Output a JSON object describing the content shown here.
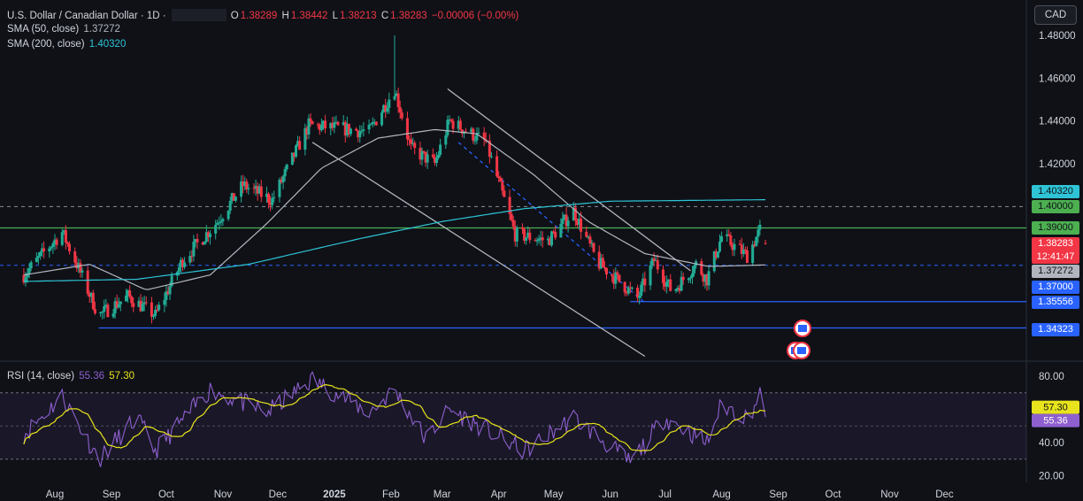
{
  "header": {
    "symbol": "U.S. Dollar / Canadian Dollar · 1D ·",
    "ohlc": {
      "o_label": "O",
      "o": "1.38289",
      "h_label": "H",
      "h": "1.38442",
      "l_label": "L",
      "l": "1.38213",
      "c_label": "C",
      "c": "1.38283",
      "change": "−0.00006 (−0.00%)"
    },
    "sma50_label": "SMA (50, close)",
    "sma50_value": "1.37272",
    "sma200_label": "SMA (200, close)",
    "sma200_value": "1.40320",
    "currency": "CAD"
  },
  "price_labels": {
    "sma200": "1.40320",
    "level_140": "1.40000",
    "level_139": "1.39000",
    "last": "1.38283",
    "countdown": "12:41:47",
    "sma50": "1.37272",
    "level_137": "1.37000",
    "level_1355": "1.35556",
    "level_1343": "1.34323"
  },
  "rsi_legend": {
    "label": "RSI (14, close)",
    "rsi": "55.36",
    "ma": "57.30"
  },
  "colors": {
    "up": "#22ab94",
    "down": "#f23645",
    "sma50": "#b2b5be",
    "sma200": "#2ec4d6",
    "green_level": "#4caf50",
    "blue_level": "#2962ff",
    "rsi": "#8e5fcf",
    "rsi_ma": "#e8e31c"
  },
  "chart_data": {
    "type": "candlestick",
    "title": "U.S. Dollar / Canadian Dollar · 1D",
    "price_axis": {
      "ticks": [
        "1.48000",
        "1.46000",
        "1.44000",
        "1.42000"
      ],
      "range": [
        1.33,
        1.48
      ]
    },
    "time_axis": {
      "ticks": [
        "Aug",
        "Sep",
        "Oct",
        "Nov",
        "Dec",
        "2025",
        "Feb",
        "Mar",
        "Apr",
        "May",
        "Jun",
        "Jul",
        "Aug",
        "Sep",
        "Oct",
        "Nov",
        "Dec"
      ]
    },
    "last_ohlc": {
      "open": 1.38289,
      "high": 1.38442,
      "low": 1.38213,
      "close": 1.38283,
      "change": -6e-05
    },
    "sma50_last": 1.37272,
    "sma200_last": 1.4032,
    "price_anchors": [
      {
        "date": "2024-07-15",
        "close": 1.368
      },
      {
        "date": "2024-08-05",
        "close": 1.388
      },
      {
        "date": "2024-08-12",
        "close": 1.375
      },
      {
        "date": "2024-08-25",
        "close": 1.349
      },
      {
        "date": "2024-09-10",
        "close": 1.358
      },
      {
        "date": "2024-09-25",
        "close": 1.349
      },
      {
        "date": "2024-10-10",
        "close": 1.375
      },
      {
        "date": "2024-10-28",
        "close": 1.392
      },
      {
        "date": "2024-11-12",
        "close": 1.41
      },
      {
        "date": "2024-11-28",
        "close": 1.403
      },
      {
        "date": "2024-12-18",
        "close": 1.438
      },
      {
        "date": "2025-01-20",
        "close": 1.435
      },
      {
        "date": "2025-02-03",
        "close": 1.455
      },
      {
        "date": "2025-02-12",
        "close": 1.427
      },
      {
        "date": "2025-02-25",
        "close": 1.42
      },
      {
        "date": "2025-03-05",
        "close": 1.44
      },
      {
        "date": "2025-03-25",
        "close": 1.43
      },
      {
        "date": "2025-04-10",
        "close": 1.387
      },
      {
        "date": "2025-04-28",
        "close": 1.384
      },
      {
        "date": "2025-05-12",
        "close": 1.398
      },
      {
        "date": "2025-05-25",
        "close": 1.374
      },
      {
        "date": "2025-06-10",
        "close": 1.362
      },
      {
        "date": "2025-06-16",
        "close": 1.357
      },
      {
        "date": "2025-06-25",
        "close": 1.375
      },
      {
        "date": "2025-07-05",
        "close": 1.36
      },
      {
        "date": "2025-07-18",
        "close": 1.373
      },
      {
        "date": "2025-07-24",
        "close": 1.366
      },
      {
        "date": "2025-08-01",
        "close": 1.386
      },
      {
        "date": "2025-08-15",
        "close": 1.377
      },
      {
        "date": "2025-08-22",
        "close": 1.389
      },
      {
        "date": "2025-08-25",
        "close": 1.3828
      }
    ],
    "spike_high": {
      "date": "2025-02-03",
      "high": 1.48
    },
    "horizontal_levels": [
      {
        "value": 1.39,
        "style": "solid",
        "color": "green"
      },
      {
        "value": 1.4,
        "style": "dashed",
        "color": "gray"
      },
      {
        "value": 1.3725,
        "style": "dashed",
        "color": "blue"
      },
      {
        "value": 1.35556,
        "style": "solid",
        "color": "blue"
      },
      {
        "value": 1.34323,
        "style": "solid",
        "color": "blue"
      }
    ],
    "trendlines": [
      {
        "from": {
          "date": "2025-03-04",
          "price": 1.455
        },
        "to": {
          "date": "2025-07-15",
          "price": 1.37
        }
      },
      {
        "from": {
          "date": "2024-12-20",
          "price": 1.43
        },
        "to": {
          "date": "2025-06-20",
          "price": 1.33
        }
      },
      {
        "from": {
          "date": "2025-03-10",
          "price": 1.43
        },
        "to": {
          "date": "2025-06-20",
          "price": 1.355
        },
        "style": "dashed"
      }
    ],
    "rsi": {
      "label": "RSI (14, close)",
      "last": 55.36,
      "ma_last": 57.3,
      "ticks": [
        80,
        40,
        20
      ],
      "overbought": 70,
      "oversold": 30,
      "anchors": [
        {
          "date": "2024-07-15",
          "value": 45
        },
        {
          "date": "2024-08-05",
          "value": 68
        },
        {
          "date": "2024-08-25",
          "value": 30
        },
        {
          "date": "2024-09-15",
          "value": 55
        },
        {
          "date": "2024-09-25",
          "value": 35
        },
        {
          "date": "2024-10-25",
          "value": 72
        },
        {
          "date": "2024-11-25",
          "value": 58
        },
        {
          "date": "2024-12-20",
          "value": 78
        },
        {
          "date": "2025-01-20",
          "value": 58
        },
        {
          "date": "2025-02-03",
          "value": 72
        },
        {
          "date": "2025-02-20",
          "value": 42
        },
        {
          "date": "2025-03-05",
          "value": 60
        },
        {
          "date": "2025-04-15",
          "value": 35
        },
        {
          "date": "2025-05-12",
          "value": 55
        },
        {
          "date": "2025-06-12",
          "value": 28
        },
        {
          "date": "2025-07-01",
          "value": 55
        },
        {
          "date": "2025-07-24",
          "value": 40
        },
        {
          "date": "2025-08-01",
          "value": 63
        },
        {
          "date": "2025-08-15",
          "value": 55
        },
        {
          "date": "2025-08-22",
          "value": 68
        },
        {
          "date": "2025-08-25",
          "value": 55.36
        }
      ]
    },
    "series": [
      {
        "name": "SMA (50, close)",
        "anchors": [
          {
            "date": "2024-07-15",
            "value": 1.368
          },
          {
            "date": "2024-08-20",
            "value": 1.373
          },
          {
            "date": "2024-09-20",
            "value": 1.361
          },
          {
            "date": "2024-10-25",
            "value": 1.368
          },
          {
            "date": "2024-11-25",
            "value": 1.392
          },
          {
            "date": "2024-12-25",
            "value": 1.418
          },
          {
            "date": "2025-01-25",
            "value": 1.432
          },
          {
            "date": "2025-02-25",
            "value": 1.436
          },
          {
            "date": "2025-03-20",
            "value": 1.434
          },
          {
            "date": "2025-04-20",
            "value": 1.415
          },
          {
            "date": "2025-05-20",
            "value": 1.393
          },
          {
            "date": "2025-06-20",
            "value": 1.378
          },
          {
            "date": "2025-07-25",
            "value": 1.372
          },
          {
            "date": "2025-08-25",
            "value": 1.3727
          }
        ]
      },
      {
        "name": "SMA (200, close)",
        "anchors": [
          {
            "date": "2024-07-15",
            "value": 1.365
          },
          {
            "date": "2024-09-15",
            "value": 1.366
          },
          {
            "date": "2024-11-15",
            "value": 1.373
          },
          {
            "date": "2025-01-15",
            "value": 1.385
          },
          {
            "date": "2025-03-01",
            "value": 1.393
          },
          {
            "date": "2025-04-15",
            "value": 1.399
          },
          {
            "date": "2025-06-01",
            "value": 1.4025
          },
          {
            "date": "2025-08-25",
            "value": 1.4032
          }
        ]
      }
    ]
  }
}
